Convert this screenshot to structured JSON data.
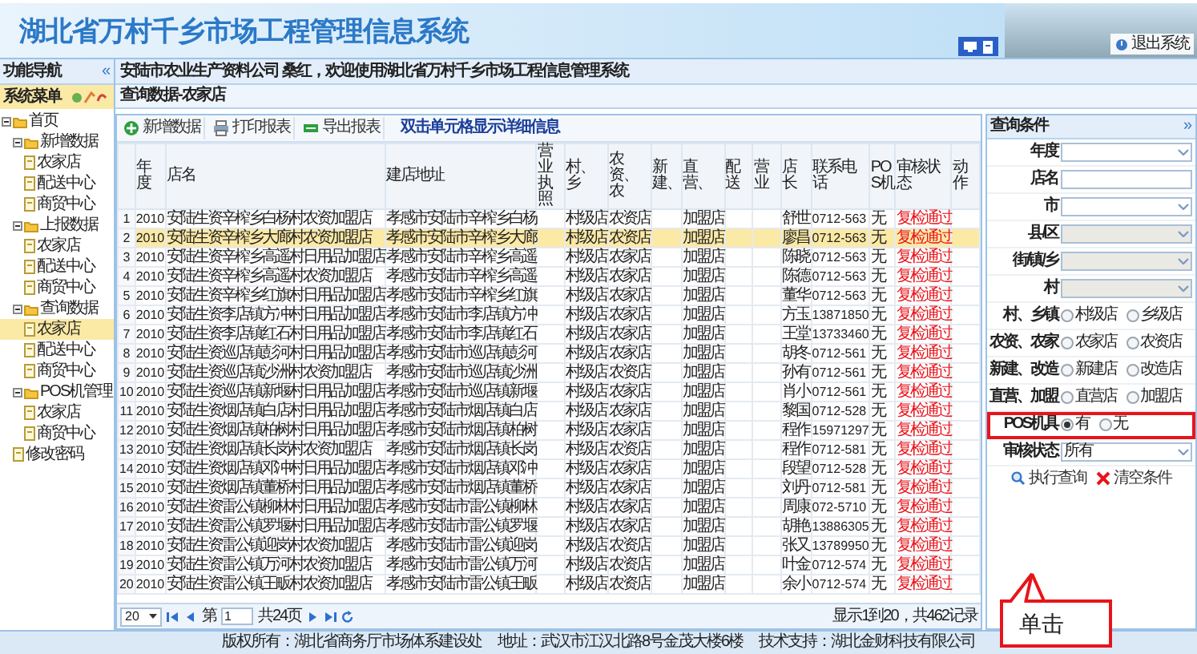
{
  "header": {
    "title": "湖北省万村千乡市场工程管理信息系统",
    "exit_button": "退出系统"
  },
  "sidebar": {
    "title": "功能导航",
    "collapse": "«",
    "menu_title": "系统菜单",
    "tree": [
      {
        "label": "首页",
        "kind": "folder",
        "expanded": true,
        "selected": false,
        "children": [
          {
            "label": "新增数据",
            "kind": "folder",
            "expanded": true,
            "selected": false,
            "children": [
              {
                "label": "农家店",
                "kind": "page",
                "selected": false
              },
              {
                "label": "配送中心",
                "kind": "page",
                "selected": false
              },
              {
                "label": "商贸中心",
                "kind": "page",
                "selected": false
              }
            ]
          },
          {
            "label": "上报数据",
            "kind": "folder",
            "expanded": true,
            "selected": false,
            "children": [
              {
                "label": "农家店",
                "kind": "page",
                "selected": false
              },
              {
                "label": "配送中心",
                "kind": "page",
                "selected": false
              },
              {
                "label": "商贸中心",
                "kind": "page",
                "selected": false
              }
            ]
          },
          {
            "label": "查询数据",
            "kind": "folder",
            "expanded": true,
            "selected": false,
            "children": [
              {
                "label": "农家店",
                "kind": "page",
                "selected": true
              },
              {
                "label": "配送中心",
                "kind": "page",
                "selected": false
              },
              {
                "label": "商贸中心",
                "kind": "page",
                "selected": false
              }
            ]
          },
          {
            "label": "POS机管理",
            "kind": "folder",
            "expanded": true,
            "selected": false,
            "children": [
              {
                "label": "农家店",
                "kind": "page",
                "selected": false
              },
              {
                "label": "商贸中心",
                "kind": "page",
                "selected": false
              }
            ]
          },
          {
            "label": "修改密码",
            "kind": "page",
            "selected": false
          }
        ]
      }
    ]
  },
  "main": {
    "welcome": "安陆市农业生产资料公司 桑红，欢迎使用湖北省万村千乡市场工程信息管理系统",
    "breadcrumb": "查询数据-农家店",
    "toolbar": [
      {
        "label": "新增数据",
        "kind": "add"
      },
      {
        "label": "打印报表",
        "kind": "print"
      },
      {
        "label": "导出报表",
        "kind": "export"
      }
    ],
    "hint": "双击单元格显示详细信息",
    "table": {
      "columns": [
        {
          "label": "年度"
        },
        {
          "label": "店名"
        },
        {
          "label": "建店地址"
        },
        {
          "label": "营业执照"
        },
        {
          "label": "村、乡"
        },
        {
          "label": "农资、农"
        },
        {
          "label": "新建、"
        },
        {
          "label": "直营、"
        },
        {
          "label": "配送"
        },
        {
          "label": "营业"
        },
        {
          "label": "店长"
        },
        {
          "label": "联系电话"
        },
        {
          "label": "POS机"
        },
        {
          "label": "审核状态"
        },
        {
          "label": "动作"
        }
      ],
      "rows": [
        {
          "index": "1",
          "selected": false,
          "year": "2010",
          "name": "安陆生资辛榨乡白杨村农资加盟店",
          "address": "孝感市安陆市辛榨乡白杨",
          "level": "村级店",
          "type": "农资店",
          "operation": "加盟店",
          "manager": "舒世",
          "phone": "0712-563",
          "pos": "无",
          "status": "复检通过"
        },
        {
          "index": "2",
          "selected": true,
          "year": "2010",
          "name": "安陆生资辛榨乡大廊村农资加盟店",
          "address": "孝感市安陆市辛榨乡大廊",
          "level": "村级店",
          "type": "农资店",
          "operation": "加盟店",
          "manager": "廖昌",
          "phone": "0712-563",
          "pos": "无",
          "status": "复检通过"
        },
        {
          "index": "3",
          "selected": false,
          "year": "2010",
          "name": "安陆生资辛榨乡高遥村日用品加盟店",
          "address": "孝感市安陆市辛榨乡高遥",
          "level": "村级店",
          "type": "农家店",
          "operation": "加盟店",
          "manager": "陈晓",
          "phone": "0712-563",
          "pos": "无",
          "status": "复检通过"
        },
        {
          "index": "4",
          "selected": false,
          "year": "2010",
          "name": "安陆生资辛榨乡高遥村农资加盟店",
          "address": "孝感市安陆市辛榨乡高遥",
          "level": "村级店",
          "type": "农家店",
          "operation": "加盟店",
          "manager": "陈德",
          "phone": "0712-563",
          "pos": "无",
          "status": "复检通过"
        },
        {
          "index": "5",
          "selected": false,
          "year": "2010",
          "name": "安陆生资辛榨乡红旗村日用品加盟店",
          "address": "孝感市安陆市辛榨乡红旗",
          "level": "村级店",
          "type": "农家店",
          "operation": "加盟店",
          "manager": "董华",
          "phone": "0712-563",
          "pos": "无",
          "status": "复检通过"
        },
        {
          "index": "6",
          "selected": false,
          "year": "2010",
          "name": "安陆生资李店镇方冲村日用品加盟店",
          "address": "孝感市安陆市李店镇方冲",
          "level": "村级店",
          "type": "农家店",
          "operation": "加盟店",
          "manager": "方玉",
          "phone": "13871850",
          "pos": "无",
          "status": "复检通过"
        },
        {
          "index": "7",
          "selected": false,
          "year": "2010",
          "name": "安陆生资李店镇红石村日用品加盟店",
          "address": "孝感市安陆市李店镇红石",
          "level": "村级店",
          "type": "农家店",
          "operation": "加盟店",
          "manager": "王堂",
          "phone": "13733460",
          "pos": "无",
          "status": "复检通过"
        },
        {
          "index": "8",
          "selected": false,
          "year": "2010",
          "name": "安陆生资巡店镇彭河村日用品加盟店",
          "address": "孝感市安陆市巡店镇彭河",
          "level": "村级店",
          "type": "农家店",
          "operation": "加盟店",
          "manager": "胡冬",
          "phone": "0712-561",
          "pos": "无",
          "status": "复检通过"
        },
        {
          "index": "9",
          "selected": false,
          "year": "2010",
          "name": "安陆生资巡店镇沙洲村农资加盟店",
          "address": "孝感市安陆市巡店镇沙洲",
          "level": "村级店",
          "type": "农资店",
          "operation": "加盟店",
          "manager": "孙有",
          "phone": "0712-561",
          "pos": "无",
          "status": "复检通过"
        },
        {
          "index": "10",
          "selected": false,
          "year": "2010",
          "name": "安陆生资巡店镇新堰村日用品加盟店",
          "address": "孝感市安陆市巡店镇新堰",
          "level": "村级店",
          "type": "农家店",
          "operation": "加盟店",
          "manager": "肖小",
          "phone": "0712-561",
          "pos": "无",
          "status": "复检通过"
        },
        {
          "index": "11",
          "selected": false,
          "year": "2010",
          "name": "安陆生资烟店镇白店村日用品加盟店",
          "address": "孝感市安陆市烟店镇白店",
          "level": "村级店",
          "type": "农家店",
          "operation": "加盟店",
          "manager": "黎国",
          "phone": "0712-528",
          "pos": "无",
          "status": "复检通过"
        },
        {
          "index": "12",
          "selected": false,
          "year": "2010",
          "name": "安陆生资烟店镇柏树村日用品加盟店",
          "address": "孝感市安陆市烟店镇柏树",
          "level": "村级店",
          "type": "农家店",
          "operation": "加盟店",
          "manager": "程作",
          "phone": "15971297",
          "pos": "无",
          "status": "复检通过"
        },
        {
          "index": "13",
          "selected": false,
          "year": "2010",
          "name": "安陆生资烟店镇长岗村农资加盟店",
          "address": "孝感市安陆市烟店镇长岗",
          "level": "村级店",
          "type": "农资店",
          "operation": "加盟店",
          "manager": "程作",
          "phone": "0712-581",
          "pos": "无",
          "status": "复检通过"
        },
        {
          "index": "14",
          "selected": false,
          "year": "2010",
          "name": "安陆生资烟店镇邓冲村日用品加盟店",
          "address": "孝感市安陆市烟店镇邓冲",
          "level": "村级店",
          "type": "农家店",
          "operation": "加盟店",
          "manager": "段望",
          "phone": "0712-528",
          "pos": "无",
          "status": "复检通过"
        },
        {
          "index": "15",
          "selected": false,
          "year": "2010",
          "name": "安陆生资烟店镇董桥村日用品加盟店",
          "address": "孝感市安陆市烟店镇董桥",
          "level": "村级店",
          "type": "农家店",
          "operation": "加盟店",
          "manager": "刘丹",
          "phone": "0712-581",
          "pos": "无",
          "status": "复检通过"
        },
        {
          "index": "16",
          "selected": false,
          "year": "2010",
          "name": "安陆生资雷公镇柳林村日用品加盟店",
          "address": "孝感市安陆市雷公镇柳林",
          "level": "村级店",
          "type": "农家店",
          "operation": "加盟店",
          "manager": "周康",
          "phone": "072-5710",
          "pos": "无",
          "status": "复检通过"
        },
        {
          "index": "17",
          "selected": false,
          "year": "2010",
          "name": "安陆生资雷公镇罗堰村日用品加盟店",
          "address": "孝感市安陆市雷公镇罗堰",
          "level": "村级店",
          "type": "农家店",
          "operation": "加盟店",
          "manager": "胡艳",
          "phone": "13886305",
          "pos": "无",
          "status": "复检通过"
        },
        {
          "index": "18",
          "selected": false,
          "year": "2010",
          "name": "安陆生资雷公镇迎岗村农资加盟店",
          "address": "孝感市安陆市雷公镇迎岗",
          "level": "村级店",
          "type": "农资店",
          "operation": "加盟店",
          "manager": "张又",
          "phone": "13789950",
          "pos": "无",
          "status": "复检通过"
        },
        {
          "index": "19",
          "selected": false,
          "year": "2010",
          "name": "安陆生资雷公镇万河村农资加盟店",
          "address": "孝感市安陆市雷公镇万河",
          "level": "村级店",
          "type": "农资店",
          "operation": "加盟店",
          "manager": "叶金",
          "phone": "0712-574",
          "pos": "无",
          "status": "复检通过"
        },
        {
          "index": "20",
          "selected": false,
          "year": "2010",
          "name": "安陆生资雷公镇王畈村农资加盟店",
          "address": "孝感市安陆市雷公镇王畈",
          "level": "村级店",
          "type": "农资店",
          "operation": "加盟店",
          "manager": "余小",
          "phone": "0712-574",
          "pos": "无",
          "status": "复检通过"
        }
      ]
    },
    "pagination": {
      "page_size": "20",
      "page_prefix": "第",
      "page": "1",
      "total_pages": "共24页",
      "summary": "显示1到20，共462记录"
    }
  },
  "query": {
    "title": "查询条件",
    "collapse": "»",
    "fields": [
      {
        "label": "年度",
        "kind": "select",
        "disabled": false,
        "highlighted": false
      },
      {
        "label": "店名",
        "kind": "text",
        "highlighted": false
      },
      {
        "label": "市",
        "kind": "select",
        "disabled": false,
        "highlighted": false
      },
      {
        "label": "县/区",
        "kind": "select",
        "disabled": true,
        "highlighted": false
      },
      {
        "label": "街/镇/乡",
        "kind": "select",
        "disabled": true,
        "highlighted": false
      },
      {
        "label": "村",
        "kind": "select",
        "disabled": true,
        "highlighted": false
      },
      {
        "label": "村、乡镇",
        "kind": "radio",
        "highlighted": false,
        "options": [
          {
            "label": "村级店",
            "selected": false
          },
          {
            "label": "乡级店",
            "selected": false
          }
        ]
      },
      {
        "label": "农资、农家",
        "kind": "radio",
        "highlighted": false,
        "options": [
          {
            "label": "农家店",
            "selected": false
          },
          {
            "label": "农资店",
            "selected": false
          }
        ]
      },
      {
        "label": "新建、改造",
        "kind": "radio",
        "highlighted": false,
        "options": [
          {
            "label": "新建店",
            "selected": false
          },
          {
            "label": "改造店",
            "selected": false
          }
        ]
      },
      {
        "label": "直营、加盟",
        "kind": "radio",
        "highlighted": false,
        "options": [
          {
            "label": "直营店",
            "selected": false
          },
          {
            "label": "加盟店",
            "selected": false
          }
        ]
      },
      {
        "label": "POS机具",
        "kind": "radio",
        "highlighted": true,
        "options": [
          {
            "label": "有",
            "selected": true
          },
          {
            "label": "无",
            "selected": false
          }
        ]
      },
      {
        "label": "审核状态",
        "kind": "select",
        "disabled": false,
        "highlighted": false,
        "value": "所有"
      }
    ],
    "buttons": [
      {
        "label": "执行查询",
        "kind": "search"
      },
      {
        "label": "清空条件",
        "kind": "clear"
      }
    ]
  },
  "annotation": {
    "text": "单击"
  },
  "footer": {
    "copyright": "版权所有：湖北省商务厅市场体系建设处",
    "address": "地址：武汉市江汉北路8号金茂大楼6楼",
    "support": "技术支持：湖北金财科技有限公司"
  }
}
